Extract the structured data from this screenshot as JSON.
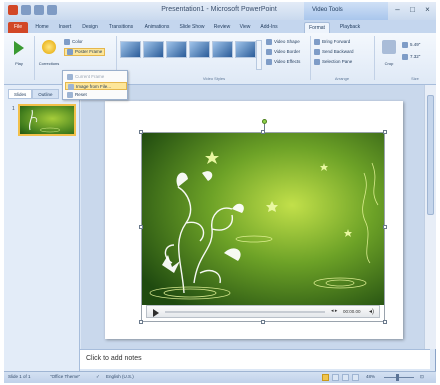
{
  "window": {
    "title": "Presentation1 - Microsoft PowerPoint",
    "context_tab_title": "Video Tools"
  },
  "tabs": [
    {
      "label": "File"
    },
    {
      "label": "Home"
    },
    {
      "label": "Insert"
    },
    {
      "label": "Design"
    },
    {
      "label": "Transitions"
    },
    {
      "label": "Animations"
    },
    {
      "label": "Slide Show"
    },
    {
      "label": "Review"
    },
    {
      "label": "View"
    },
    {
      "label": "Add-Ins"
    },
    {
      "label": "Format"
    },
    {
      "label": "Playback"
    }
  ],
  "ribbon": {
    "play_label": "Play",
    "corrections_label": "Corrections",
    "color_label": "Color",
    "poster_frame_label": "Poster Frame",
    "reset_label": "Reset",
    "video_shape_label": "Video Shape",
    "video_border_label": "Video Border",
    "video_effects_label": "Video Effects",
    "bring_forward_label": "Bring Forward",
    "send_backward_label": "Send Backward",
    "selection_pane_label": "Selection Pane",
    "crop_label": "Crop",
    "height_value": "5.49\"",
    "width_value": "7.32\"",
    "group_video_styles": "Video Styles",
    "group_arrange": "Arrange",
    "group_size": "Size"
  },
  "poster_menu": {
    "items": [
      {
        "label": "Current Frame",
        "enabled": false
      },
      {
        "label": "Image from File...",
        "enabled": true,
        "highlighted": true
      },
      {
        "label": "Reset",
        "enabled": true
      }
    ]
  },
  "left_pane": {
    "tabs": [
      "Slides",
      "Outline"
    ],
    "close_glyph": "×",
    "slide_number": "1"
  },
  "slide": {
    "notes_placeholder": "Click to add notes"
  },
  "video_controls": {
    "time": "00:00.00",
    "seek_glyph": "◂ ▸"
  },
  "status": {
    "slide_info": "Slide 1 of 1",
    "theme": "\"Office Theme\"",
    "language": "English (U.S.)",
    "zoom": "48%"
  },
  "colors": {
    "file_tab": "#d24726",
    "video_bg_light": "#a6cd3a",
    "video_bg_dark": "#245512",
    "selection_highlight": "#fde69a"
  }
}
